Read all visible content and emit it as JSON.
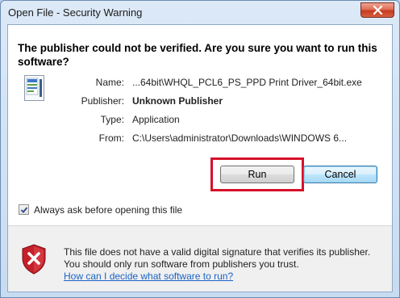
{
  "window": {
    "title": "Open File - Security Warning"
  },
  "heading": "The publisher could not be verified.  Are you sure you want to run this software?",
  "info": {
    "name_label": "Name:",
    "name_value": "...64bit\\WHQL_PCL6_PS_PPD Print Driver_64bit.exe",
    "publisher_label": "Publisher:",
    "publisher_value": "Unknown Publisher",
    "type_label": "Type:",
    "type_value": "Application",
    "from_label": "From:",
    "from_value": "C:\\Users\\administrator\\Downloads\\WINDOWS 6..."
  },
  "buttons": {
    "run": "Run",
    "cancel": "Cancel"
  },
  "checkbox": {
    "label": "Always ask before opening this file",
    "checked": true
  },
  "warning": {
    "text": "This file does not have a valid digital signature that verifies its publisher.  You should only run software from publishers you trust.",
    "link": "How can I decide what software to run?"
  },
  "colors": {
    "highlight": "#d6112a",
    "link": "#1a63c7",
    "shield": "#c4202a"
  },
  "icons": {
    "close": "close-icon",
    "file": "application-file-icon",
    "checkmark": "checkmark-icon",
    "shield": "security-shield-error-icon"
  }
}
